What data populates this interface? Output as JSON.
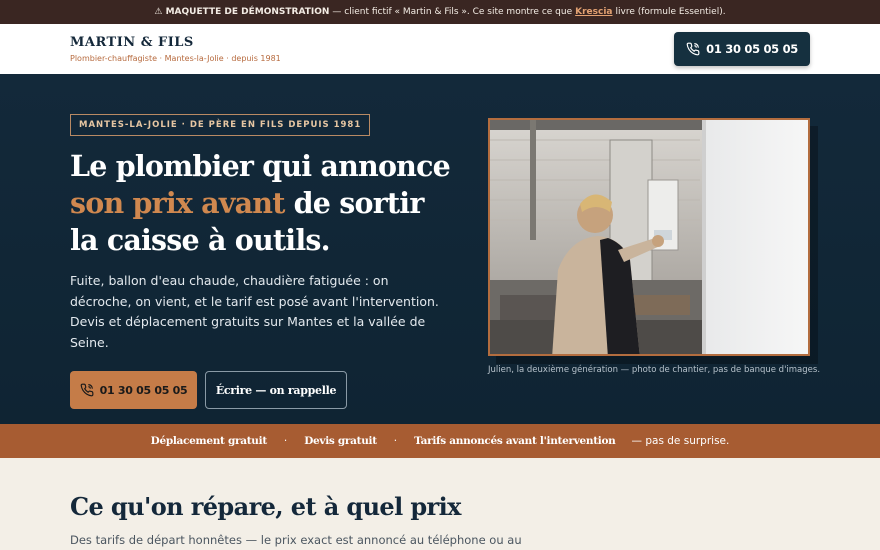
{
  "demo_bar": {
    "icon": "warning-icon",
    "label": "⚠ MAQUETTE DE DÉMONSTRATION",
    "text_before": "— client fictif « Martin & Fils ». Ce site montre ce que",
    "link": "Krescia",
    "text_after": "livre (formule Essentiel)."
  },
  "header": {
    "brand": "MARTIN & FILS",
    "tagline": "Plombier-chauffagiste · Mantes-la-Jolie · depuis 1981",
    "phone": "01 30 05 05 05"
  },
  "hero": {
    "eyebrow": "MANTES-LA-JOLIE · DE PÈRE EN FILS DEPUIS 1981",
    "title_line1": "Le plombier qui annonce",
    "title_accent": "son prix avant",
    "title_rest": " de sortir",
    "title_line3": "la caisse à outils.",
    "description": "Fuite, ballon d'eau chaude, chaudière fatiguée : on décroche, on vient, et le tarif est posé avant l'intervention. Devis et déplacement gratuits sur Mantes et la vallée de Seine.",
    "cta_phone": "01 30 05 05 05",
    "cta_write": "Écrire — on rappelle",
    "caption": "Julien, la deuxième génération — photo de chantier, pas de banque d'images."
  },
  "band": {
    "items": [
      "Déplacement gratuit",
      "Devis gratuit",
      "Tarifs annoncés avant l'intervention"
    ],
    "separator": "·",
    "tail": "— pas de surprise."
  },
  "section": {
    "title": "Ce qu'on répare, et à quel prix",
    "description": "Des tarifs de départ honnêtes — le prix exact est annoncé au téléphone ou au"
  },
  "colors": {
    "navy": "#13293a",
    "copper": "#c57c48",
    "band": "#a75c32",
    "cream": "#f3efe7"
  }
}
